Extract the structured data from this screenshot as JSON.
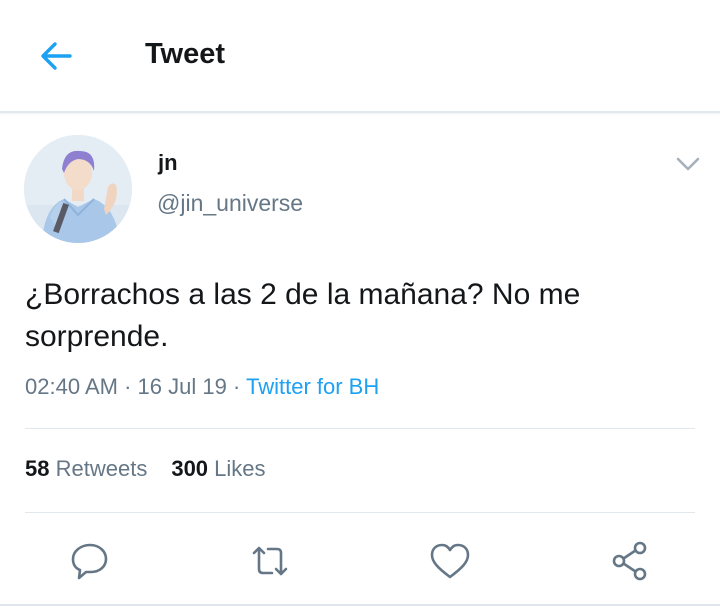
{
  "header": {
    "title": "Tweet",
    "back_icon": "arrow-left-icon"
  },
  "tweet": {
    "display_name": "jn",
    "handle": "@jin_universe",
    "text": "¿Borrachos a las 2 de la mañana? No me sorprende.",
    "time": "02:40 AM",
    "date": "16 Jul 19",
    "source": "Twitter for BH",
    "retweets_count": "58",
    "retweets_label": "Retweets",
    "likes_count": "300",
    "likes_label": "Likes"
  },
  "actions": [
    "reply-icon",
    "retweet-icon",
    "like-icon",
    "share-icon"
  ],
  "colors": {
    "accent": "#1da1f2",
    "muted": "#657786",
    "text": "#14171a",
    "divider": "#e1e8ed"
  }
}
